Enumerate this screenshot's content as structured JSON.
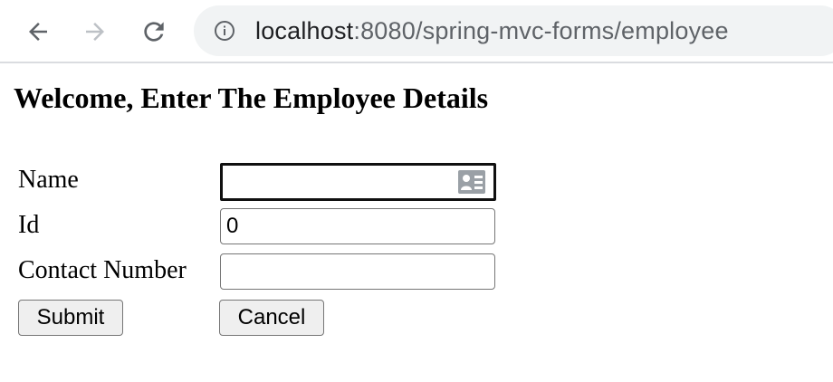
{
  "browser": {
    "url_host": "localhost",
    "url_path": ":8080/spring-mvc-forms/employee",
    "icons": {
      "back": "arrow-left-icon",
      "forward": "arrow-right-icon",
      "reload": "reload-icon",
      "site_info": "info-circle-icon"
    }
  },
  "page": {
    "heading": "Welcome, Enter The Employee Details",
    "form": {
      "name_label": "Name",
      "name_value": "",
      "id_label": "Id",
      "id_value": "0",
      "contact_label": "Contact Number",
      "contact_value": "",
      "submit_label": "Submit",
      "cancel_label": "Cancel",
      "autofill_icon": "contact-card-icon"
    }
  },
  "colors": {
    "toolbar_icon": "#5f6368",
    "forward_disabled": "#bdc1c6",
    "address_bar_bg": "#f1f3f4",
    "button_bg": "#efefef"
  }
}
